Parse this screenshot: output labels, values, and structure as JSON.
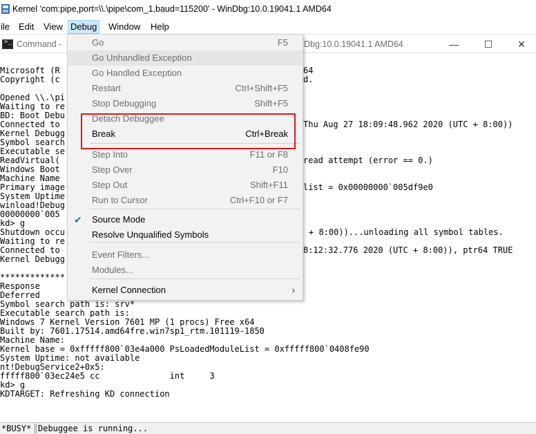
{
  "window": {
    "title": "Kernel 'com:pipe,port=\\\\.\\pipe\\com_1,baud=115200' - WinDbg:10.0.19041.1 AMD64"
  },
  "menubar": [
    "ile",
    "Edit",
    "View",
    "Debug",
    "Window",
    "Help"
  ],
  "command_window": {
    "title": "Command -",
    "title_right": "Dbg:10.0.19041.1 AMD64",
    "minimize": "—",
    "maximize": "☐",
    "close": "✕"
  },
  "console_lines": [
    "Microsoft (R",
    "Copyright (c",
    "",
    "Opened \\\\.\\pi",
    "Waiting to re",
    "BD: Boot Debu",
    "Connected to",
    "Kernel Debugg",
    "Symbol search",
    "Executable se",
    "ReadVirtual(",
    "Windows Boot",
    "Machine Name",
    "Primary image",
    "System Uptime",
    "winload!Debug",
    "00000000`005",
    "kd> g",
    "Shutdown occu",
    "Waiting to re",
    "Connected to",
    "Kernel Debugg",
    "",
    "*************",
    "Response",
    "Deferred",
    "Symbol search path is: srv*",
    "Executable search path is:",
    "Windows 7 Kernel Version 7601 MP (1 procs) Free x64",
    "Built by: 7601.17514.amd64fre.win7sp1_rtm.101119-1850",
    "Machine Name:",
    "Kernel base = 0xfffff800`03e4a000 PsLoadedModuleList = 0xfffff800`0408fe90",
    "System Uptime: not available",
    "nt!DebugService2+0x5:",
    "fffff800`03ec24e5 cc              int     3",
    "kd> g",
    "KDTARGET: Refreshing KD connection"
  ],
  "console_right": [
    {
      "row": 0,
      "text": "64"
    },
    {
      "row": 1,
      "text": "d."
    },
    {
      "row": 6,
      "text": "Thu Aug 27 18:09:48.962 2020 (UTC + 8:00))"
    },
    {
      "row": 10,
      "text": "read attempt (error == 0.)"
    },
    {
      "row": 13,
      "text": "list = 0x00000000`005df9e0"
    },
    {
      "row": 18,
      "text": "+ 8:00))...unloading all symbol tables."
    },
    {
      "row": 20,
      "text": "8:12:32.776 2020 (UTC + 8:00)), ptr64 TRUE"
    }
  ],
  "debug_menu": [
    {
      "label": "Go",
      "shortcut": "F5",
      "disabled": true
    },
    {
      "label": "Go Unhandled Exception",
      "shortcut": "",
      "disabled": true,
      "hover": true
    },
    {
      "label": "Go Handled Exception",
      "shortcut": "",
      "disabled": true
    },
    {
      "label": "Restart",
      "shortcut": "Ctrl+Shift+F5",
      "disabled": true
    },
    {
      "label": "Stop Debugging",
      "shortcut": "Shift+F5",
      "disabled": true
    },
    {
      "label": "Detach Debuggee",
      "shortcut": "",
      "disabled": true
    },
    {
      "label": "Break",
      "shortcut": "Ctrl+Break",
      "disabled": false
    },
    {
      "label": "Step Into",
      "shortcut": "F11 or F8",
      "disabled": true
    },
    {
      "label": "Step Over",
      "shortcut": "F10",
      "disabled": true
    },
    {
      "label": "Step Out",
      "shortcut": "Shift+F11",
      "disabled": true
    },
    {
      "label": "Run to Cursor",
      "shortcut": "Ctrl+F10 or F7",
      "disabled": true
    },
    {
      "label": "Source Mode",
      "shortcut": "",
      "disabled": false,
      "checked": true
    },
    {
      "label": "Resolve Unqualified Symbols",
      "shortcut": "",
      "disabled": false
    },
    {
      "label": "Event Filters...",
      "shortcut": "",
      "disabled": true
    },
    {
      "label": "Modules...",
      "shortcut": "",
      "disabled": true
    },
    {
      "label": "Kernel Connection",
      "shortcut": "",
      "disabled": false,
      "submenu": true
    }
  ],
  "icons": {
    "check": "checkmark-icon",
    "submenu": "chevron-right-icon"
  },
  "statusbar": {
    "busy": "*BUSY*",
    "message": "Debuggee is running..."
  },
  "colors": {
    "accent": "#e3151b",
    "menu_bg": "#f2f2f2",
    "disabled_text": "#6d6d6d",
    "check": "#1e6fc5"
  }
}
